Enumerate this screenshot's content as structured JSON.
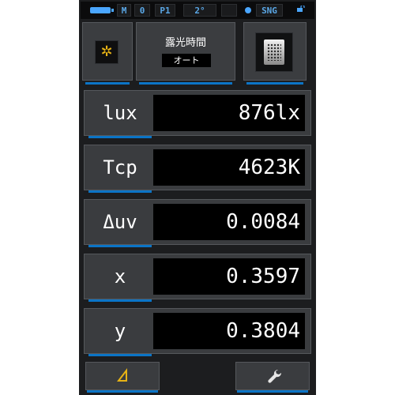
{
  "status_bar": {
    "memory": "M",
    "number": "0",
    "preset": "P1",
    "angle": "2°",
    "mode": "SNG"
  },
  "header": {
    "title": "露光時間",
    "mode": "オート"
  },
  "measurements": [
    {
      "label": "lux",
      "value": "876lx"
    },
    {
      "label": "Tcp",
      "value": "4623K"
    },
    {
      "label": "Δuv",
      "value": "0.0084"
    },
    {
      "label": "x",
      "value": "0.3597"
    },
    {
      "label": "y",
      "value": "0.3804"
    }
  ],
  "icons": {
    "battery": "battery-icon",
    "lock": "lock-icon",
    "sun": "sun-icon",
    "memory": "memory-card-icon",
    "delta": "delta-icon",
    "settings": "wrench-icon"
  },
  "colors": {
    "accent": "#0b74c6",
    "status_text": "#5aa7e6",
    "icon_yellow": "#e7b315",
    "panel": "#3a3c3f",
    "value_bg": "#000000"
  }
}
